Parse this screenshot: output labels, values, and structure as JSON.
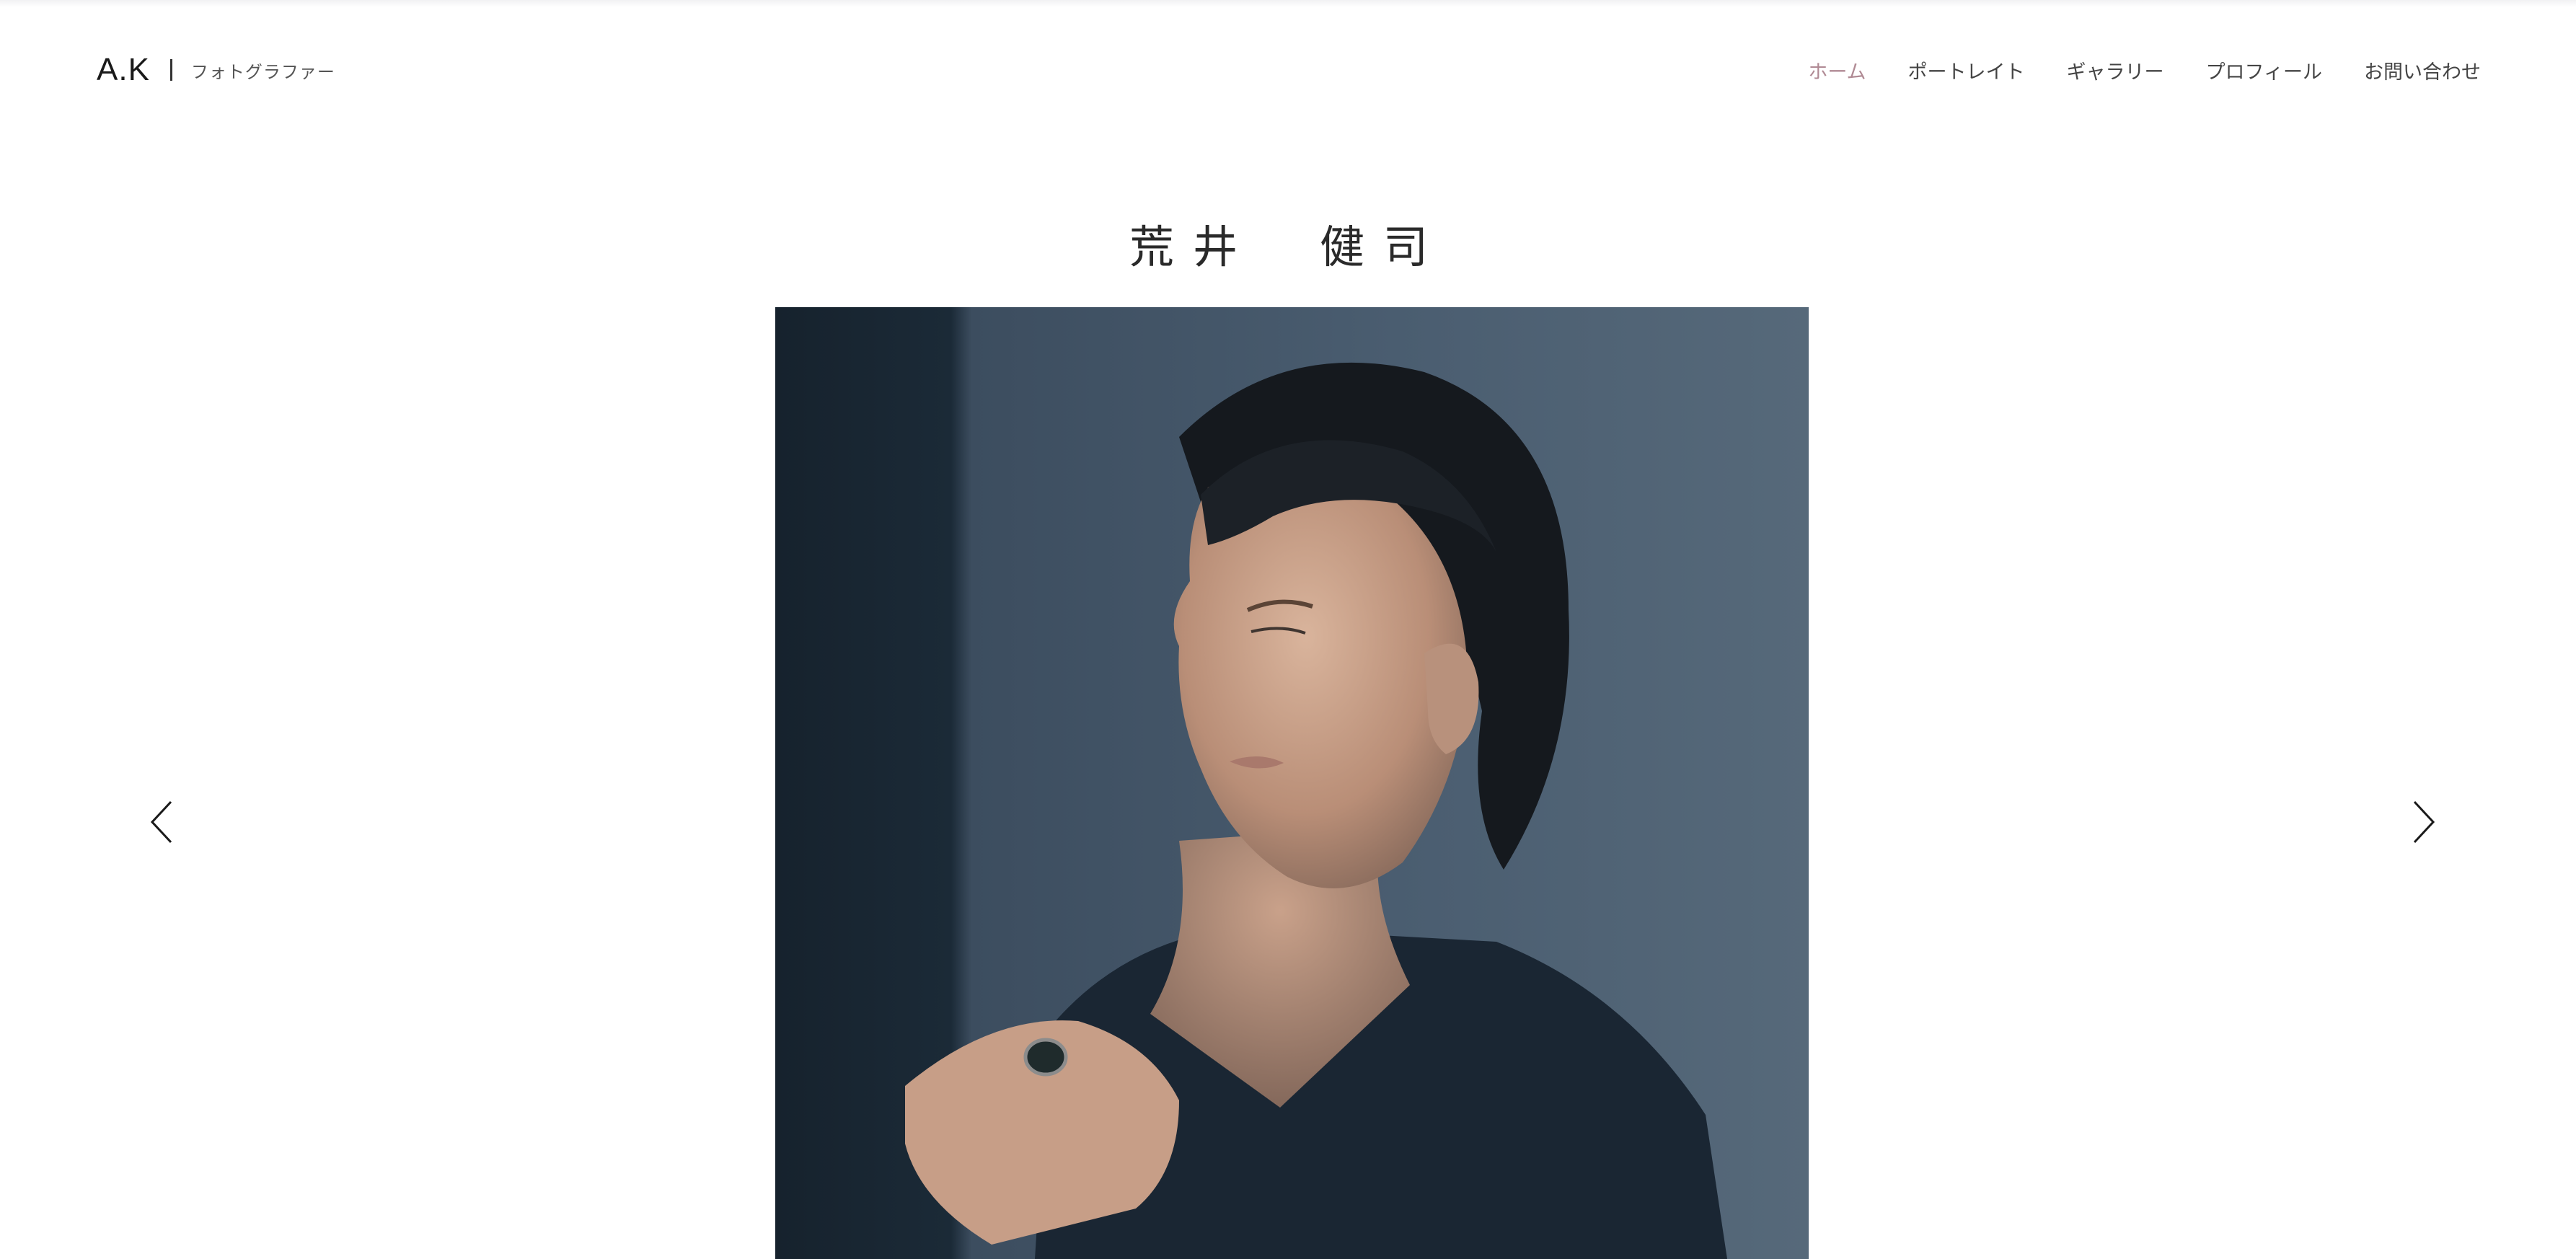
{
  "header": {
    "logo": "A.K",
    "tagline": "フォトグラファー",
    "nav": [
      {
        "label": "ホーム",
        "active": true
      },
      {
        "label": "ポートレイト",
        "active": false
      },
      {
        "label": "ギャラリー",
        "active": false
      },
      {
        "label": "プロフィール",
        "active": false
      },
      {
        "label": "お問い合わせ",
        "active": false
      }
    ],
    "active_color": "#b08a94"
  },
  "main": {
    "title": "荒井　健司",
    "hero": {
      "image_icon": "portrait-photo"
    },
    "slider": {
      "prev_icon": "chevron-left-icon",
      "next_icon": "chevron-right-icon"
    }
  }
}
